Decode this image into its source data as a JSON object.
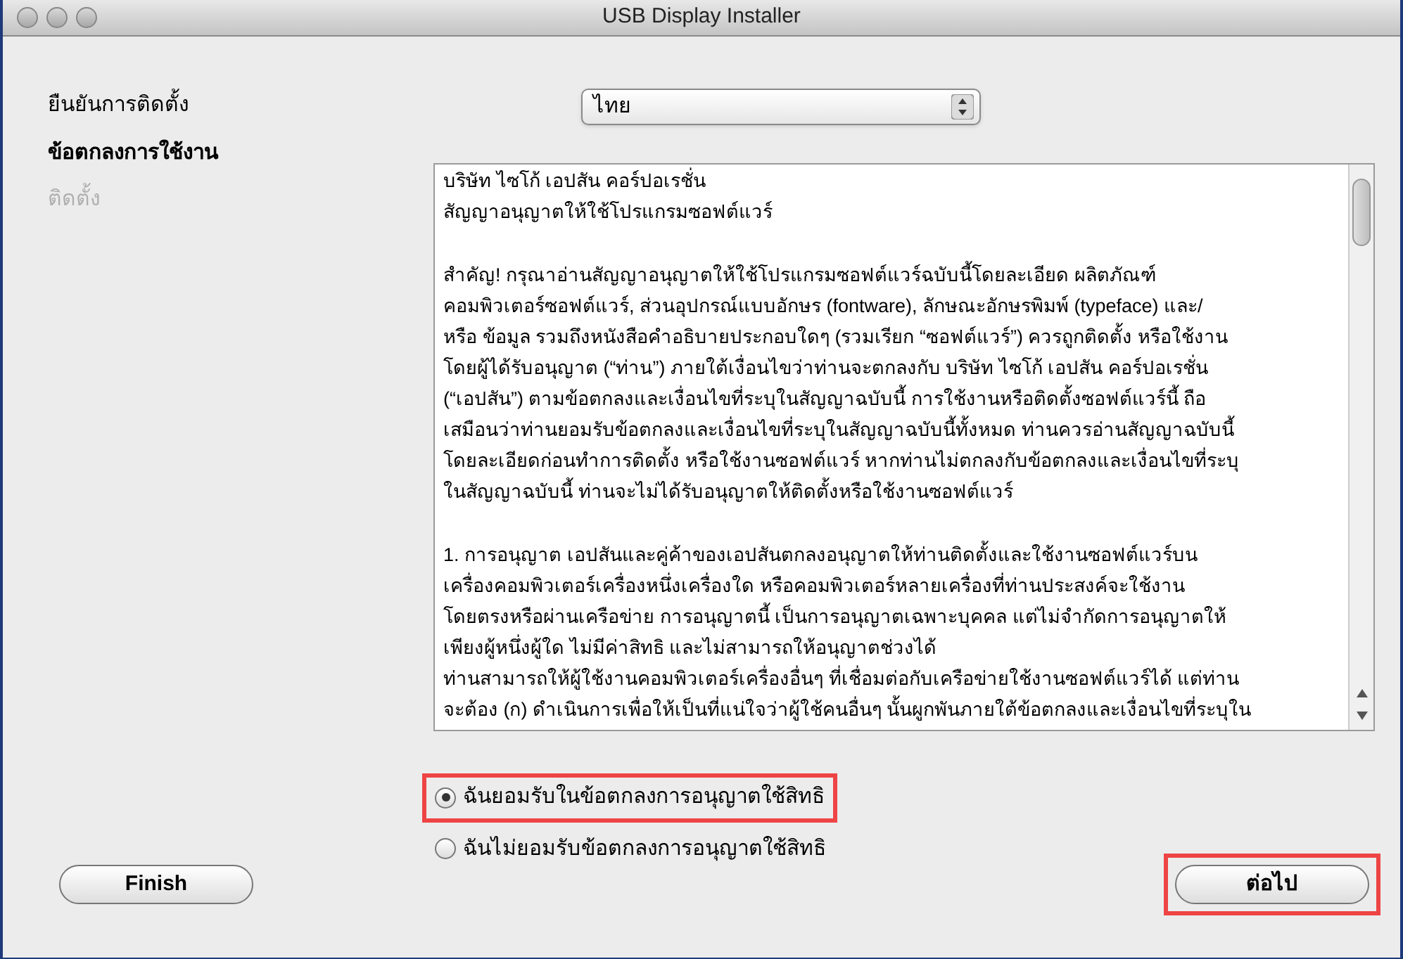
{
  "window": {
    "title": "USB Display Installer"
  },
  "sidebar": {
    "items": [
      {
        "label": "ยืนยันการติดตั้ง",
        "selected": false,
        "disabled": false
      },
      {
        "label": "ข้อตกลงการใช้งาน",
        "selected": true,
        "disabled": false
      },
      {
        "label": "ติดตั้ง",
        "selected": false,
        "disabled": true
      }
    ]
  },
  "language_select": {
    "value": "ไทย"
  },
  "license": {
    "paragraphs": [
      [
        "บริษัท ไซโก้ เอปสัน คอร์ปอเรชั่น",
        "สัญญาอนุญาตให้ใช้โปรแกรมซอฟต์แวร์"
      ],
      [
        "สำคัญ! กรุณาอ่านสัญญาอนุญาตให้ใช้โปรแกรมซอฟต์แวร์ฉบับนี้โดยละเอียด ผลิตภัณฑ์",
        "คอมพิวเตอร์ซอฟต์แวร์, ส่วนอุปกรณ์แบบอักษร (fontware), ลักษณะอักษรพิมพ์ (typeface) และ/",
        "หรือ ข้อมูล รวมถึงหนังสือคำอธิบายประกอบใดๆ (รวมเรียก “ซอฟต์แวร์”) ควรถูกติดตั้ง หรือใช้งาน",
        "โดยผู้ได้รับอนุญาต (“ท่าน”) ภายใต้เงื่อนไขว่าท่านจะตกลงกับ บริษัท ไซโก้ เอปสัน คอร์ปอเรชั่น",
        "(“เอปสัน”) ตามข้อตกลงและเงื่อนไขที่ระบุในสัญญาฉบับนี้ การใช้งานหรือติดตั้งซอฟต์แวร์นี้ ถือ",
        "เสมือนว่าท่านยอมรับข้อตกลงและเงื่อนไขที่ระบุในสัญญาฉบับนี้ทั้งหมด ท่านควรอ่านสัญญาฉบับนี้",
        "โดยละเอียดก่อนทำการติดตั้ง หรือใช้งานซอฟต์แวร์ หากท่านไม่ตกลงกับข้อตกลงและเงื่อนไขที่ระบุ",
        "ในสัญญาฉบับนี้ ท่านจะไม่ได้รับอนุญาตให้ติดตั้งหรือใช้งานซอฟต์แวร์"
      ],
      [
        "1. การอนุญาต เอปสันและคู่ค้าของเอปสันตกลงอนุญาตให้ท่านติดตั้งและใช้งานซอฟต์แวร์บน",
        "เครื่องคอมพิวเตอร์เครื่องหนึ่งเครื่องใด หรือคอมพิวเตอร์หลายเครื่องที่ท่านประสงค์จะใช้งาน",
        "โดยตรงหรือผ่านเครือข่าย การอนุญาตนี้ เป็นการอนุญาตเฉพาะบุคคล แต่ไม่จำกัดการอนุญาตให้",
        "เพียงผู้หนึ่งผู้ใด ไม่มีค่าสิทธิ และไม่สามารถให้อนุญาตช่วงได้",
        "ท่านสามารถให้ผู้ใช้งานคอมพิวเตอร์เครื่องอื่นๆ ที่เชื่อมต่อกับเครือข่ายใช้งานซอฟต์แวร์ได้ แต่ท่าน",
        "จะต้อง (ก) ดำเนินการเพื่อให้เป็นที่แน่ใจว่าผู้ใช้คนอื่นๆ นั้นผูกพันภายใต้ข้อตกลงและเงื่อนไขที่ระบุใน"
      ]
    ]
  },
  "agreement_options": [
    {
      "label": "ฉันยอมรับในข้อตกลงการอนุญาตใช้สิทธิ",
      "selected": true,
      "highlighted": true
    },
    {
      "label": "ฉันไม่ยอมรับข้อตกลงการอนุญาตใช้สิทธิ",
      "selected": false,
      "highlighted": false
    }
  ],
  "buttons": [
    {
      "label": "Finish",
      "highlighted": false
    },
    {
      "label": "ต่อไป",
      "highlighted": true
    }
  ]
}
